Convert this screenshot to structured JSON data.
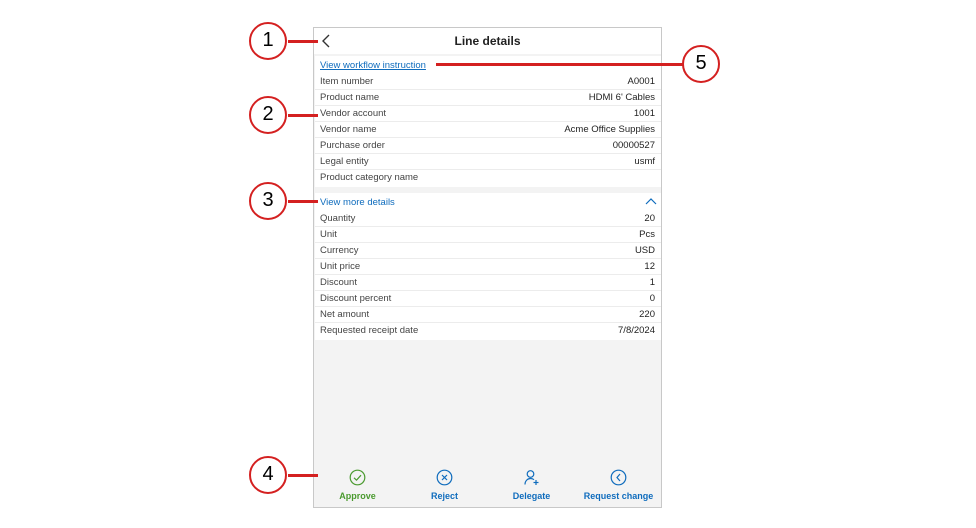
{
  "header": {
    "title": "Line details"
  },
  "workflow_link": "View workflow instruction",
  "details": [
    {
      "label": "Item number",
      "value": "A0001"
    },
    {
      "label": "Product name",
      "value": "HDMI 6' Cables"
    },
    {
      "label": "Vendor account",
      "value": "1001"
    },
    {
      "label": "Vendor name",
      "value": "Acme Office Supplies"
    },
    {
      "label": "Purchase order",
      "value": "00000527"
    },
    {
      "label": "Legal entity",
      "value": "usmf"
    },
    {
      "label": "Product category name",
      "value": ""
    }
  ],
  "more_details_link": "View more details",
  "more_details": [
    {
      "label": "Quantity",
      "value": "20"
    },
    {
      "label": "Unit",
      "value": "Pcs"
    },
    {
      "label": "Currency",
      "value": "USD"
    },
    {
      "label": "Unit price",
      "value": "12"
    },
    {
      "label": "Discount",
      "value": "1"
    },
    {
      "label": "Discount percent",
      "value": "0"
    },
    {
      "label": "Net amount",
      "value": "220"
    },
    {
      "label": "Requested receipt date",
      "value": "7/8/2024"
    }
  ],
  "toolbar": [
    {
      "label": "Approve",
      "icon": "check-circle-icon",
      "color": "#4a9a2f"
    },
    {
      "label": "Reject",
      "icon": "x-circle-icon",
      "color": "#0f6cbd"
    },
    {
      "label": "Delegate",
      "icon": "person-add-icon",
      "color": "#0f6cbd"
    },
    {
      "label": "Request change",
      "icon": "back-circle-icon",
      "color": "#0f6cbd"
    }
  ],
  "callouts": [
    "1",
    "2",
    "3",
    "4",
    "5"
  ],
  "colors": {
    "accent": "#0f6cbd",
    "approve": "#4a9a2f",
    "callout": "#d42020"
  }
}
